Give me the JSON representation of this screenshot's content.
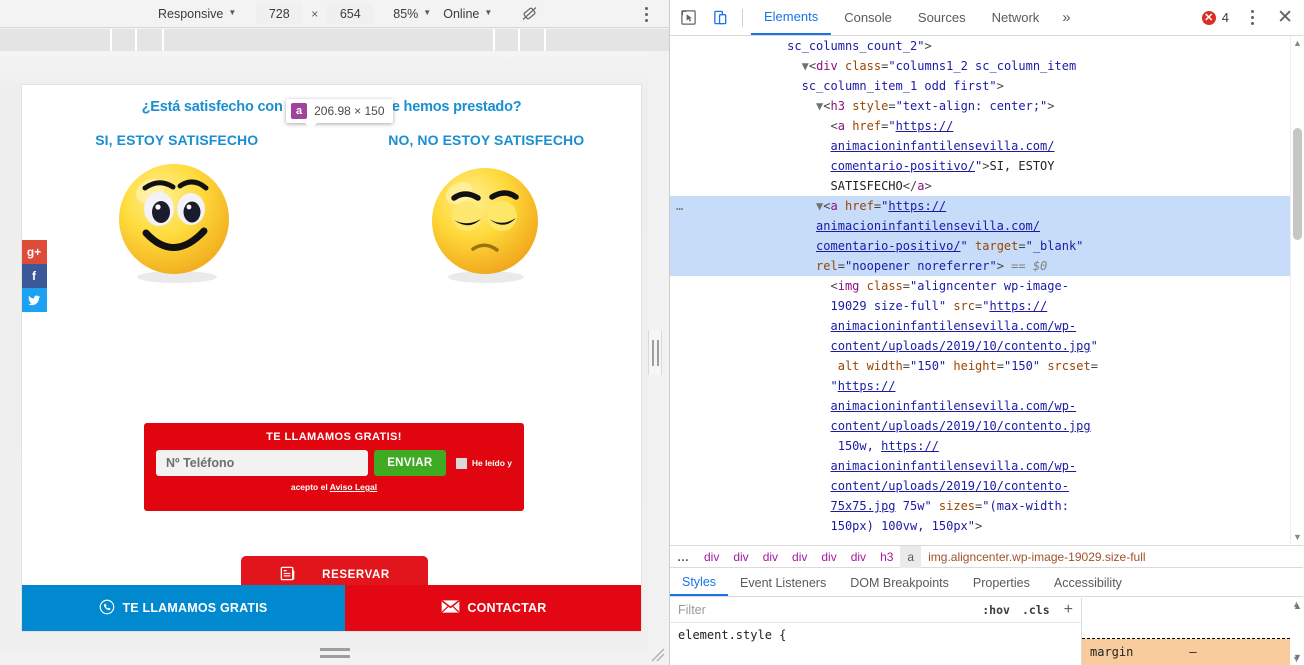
{
  "device_toolbar": {
    "device_label": "Responsive",
    "width": "728",
    "height": "654",
    "zoom": "85%",
    "throttle": "Online",
    "rotate_icon": "rotate-icon",
    "menu_icon": "more-vertical-icon"
  },
  "page": {
    "question": "¿Está satisfecho con el servicio que le hemos prestado?",
    "columns": [
      {
        "heading": "SI, ESTOY SATISFECHO",
        "image": "happy-smiley"
      },
      {
        "heading": "NO, NO ESTOY SATISFECHO",
        "image": "sad-smiley"
      }
    ],
    "social": [
      {
        "name": "google-plus",
        "glyph": "g+",
        "color": "#dd4b39"
      },
      {
        "name": "facebook",
        "glyph": "f",
        "color": "#3b5998"
      },
      {
        "name": "twitter",
        "glyph": "🐦",
        "color": "#1da1f2"
      }
    ],
    "call_form": {
      "title": "TE LLAMAMOS GRATIS!",
      "phone_placeholder": "Nº Teléfono",
      "phone_value": "",
      "submit_label": "ENVIAR",
      "consent_line1": "He leído y",
      "consent_line2_prefix": "acepto el ",
      "consent_link": "Aviso Legal"
    },
    "reserve_button": {
      "label": "RESERVAR",
      "icon": "document-icon"
    },
    "cta_bars": [
      {
        "label": "TE LLAMAMOS GRATIS",
        "icon": "phone-icon",
        "color": "#0089cf"
      },
      {
        "label": "CONTACTAR",
        "icon": "envelope-icon",
        "color": "#e30613"
      }
    ]
  },
  "overlay_tooltip": {
    "tag": "a",
    "dimensions": "206.98 × 150"
  },
  "devtools": {
    "tabs": [
      {
        "label": "Elements",
        "active": true
      },
      {
        "label": "Console",
        "active": false
      },
      {
        "label": "Sources",
        "active": false
      },
      {
        "label": "Network",
        "active": false
      }
    ],
    "more_tabs_glyph": "»",
    "error_count": "4",
    "error_badge_glyph": "✕",
    "inspect_icon": "inspect-element-icon",
    "device_icon": "toggle-device-toolbar-icon",
    "menu_icon": "more-vertical-icon",
    "close_icon": "close-icon",
    "dom": {
      "lines": [
        {
          "indent": 7,
          "selected": false,
          "parts": [
            {
              "t": "attrval",
              "v": "sc_columns_count_2\""
            },
            {
              "t": "punc",
              "v": ">"
            }
          ]
        },
        {
          "indent": 8,
          "selected": false,
          "parts": [
            {
              "t": "arrow",
              "v": "▼"
            },
            {
              "t": "punc",
              "v": "<"
            },
            {
              "t": "tagname",
              "v": "div"
            },
            {
              "t": "txt",
              "v": " "
            },
            {
              "t": "attrname",
              "v": "class"
            },
            {
              "t": "punc",
              "v": "="
            },
            {
              "t": "attrval",
              "v": "\"columns1_2 sc_column_item"
            }
          ]
        },
        {
          "indent": 8,
          "selected": false,
          "parts": [
            {
              "t": "attrval",
              "v": "sc_column_item_1 odd first\""
            },
            {
              "t": "punc",
              "v": ">"
            }
          ]
        },
        {
          "indent": 9,
          "selected": false,
          "parts": [
            {
              "t": "arrow",
              "v": "▼"
            },
            {
              "t": "punc",
              "v": "<"
            },
            {
              "t": "tagname",
              "v": "h3"
            },
            {
              "t": "txt",
              "v": " "
            },
            {
              "t": "attrname",
              "v": "style"
            },
            {
              "t": "punc",
              "v": "="
            },
            {
              "t": "attrval",
              "v": "\"text-align: center;\""
            },
            {
              "t": "punc",
              "v": ">"
            }
          ]
        },
        {
          "indent": 10,
          "selected": false,
          "parts": [
            {
              "t": "punc",
              "v": "<"
            },
            {
              "t": "tagname",
              "v": "a"
            },
            {
              "t": "txt",
              "v": " "
            },
            {
              "t": "attrname",
              "v": "href"
            },
            {
              "t": "punc",
              "v": "="
            },
            {
              "t": "attrval",
              "v": "\""
            },
            {
              "t": "attrlink",
              "v": "https://"
            }
          ]
        },
        {
          "indent": 10,
          "selected": false,
          "parts": [
            {
              "t": "attrlink",
              "v": "animacioninfantilensevilla.com/"
            }
          ]
        },
        {
          "indent": 10,
          "selected": false,
          "parts": [
            {
              "t": "attrlink",
              "v": "comentario-positivo/"
            },
            {
              "t": "attrval",
              "v": "\""
            },
            {
              "t": "punc",
              "v": ">"
            },
            {
              "t": "txt",
              "v": "SI, ESTOY"
            }
          ]
        },
        {
          "indent": 10,
          "selected": false,
          "parts": [
            {
              "t": "txt",
              "v": "SATISFECHO"
            },
            {
              "t": "punc",
              "v": "</"
            },
            {
              "t": "tagname",
              "v": "a"
            },
            {
              "t": "punc",
              "v": ">"
            }
          ]
        },
        {
          "indent": 9,
          "selected": true,
          "gutter": "…",
          "parts": [
            {
              "t": "arrow",
              "v": "▼"
            },
            {
              "t": "punc",
              "v": "<"
            },
            {
              "t": "tagname",
              "v": "a"
            },
            {
              "t": "txt",
              "v": " "
            },
            {
              "t": "attrname",
              "v": "href"
            },
            {
              "t": "punc",
              "v": "="
            },
            {
              "t": "attrval",
              "v": "\""
            },
            {
              "t": "attrlink",
              "v": "https://"
            }
          ]
        },
        {
          "indent": 9,
          "selected": true,
          "parts": [
            {
              "t": "attrlink",
              "v": "animacioninfantilensevilla.com/"
            }
          ]
        },
        {
          "indent": 9,
          "selected": true,
          "parts": [
            {
              "t": "attrlink",
              "v": "comentario-positivo/"
            },
            {
              "t": "attrval",
              "v": "\""
            },
            {
              "t": "txt",
              "v": " "
            },
            {
              "t": "attrname",
              "v": "target"
            },
            {
              "t": "punc",
              "v": "="
            },
            {
              "t": "attrval",
              "v": "\"_blank\""
            }
          ]
        },
        {
          "indent": 9,
          "selected": true,
          "parts": [
            {
              "t": "attrname",
              "v": "rel"
            },
            {
              "t": "punc",
              "v": "="
            },
            {
              "t": "attrval",
              "v": "\"noopener noreferrer\""
            },
            {
              "t": "punc",
              "v": ">"
            },
            {
              "t": "dollar",
              "v": " == $0"
            }
          ]
        },
        {
          "indent": 10,
          "selected": false,
          "parts": [
            {
              "t": "punc",
              "v": "<"
            },
            {
              "t": "tagname",
              "v": "img"
            },
            {
              "t": "txt",
              "v": " "
            },
            {
              "t": "attrname",
              "v": "class"
            },
            {
              "t": "punc",
              "v": "="
            },
            {
              "t": "attrval",
              "v": "\"aligncenter wp-image-"
            }
          ]
        },
        {
          "indent": 10,
          "selected": false,
          "parts": [
            {
              "t": "attrval",
              "v": "19029 size-full\""
            },
            {
              "t": "txt",
              "v": " "
            },
            {
              "t": "attrname",
              "v": "src"
            },
            {
              "t": "punc",
              "v": "="
            },
            {
              "t": "attrval",
              "v": "\""
            },
            {
              "t": "attrlink",
              "v": "https://"
            }
          ]
        },
        {
          "indent": 10,
          "selected": false,
          "parts": [
            {
              "t": "attrlink",
              "v": "animacioninfantilensevilla.com/wp-"
            }
          ]
        },
        {
          "indent": 10,
          "selected": false,
          "parts": [
            {
              "t": "attrlink",
              "v": "content/uploads/2019/10/contento.jpg"
            },
            {
              "t": "attrval",
              "v": "\""
            }
          ]
        },
        {
          "indent": 10,
          "selected": false,
          "parts": [
            {
              "t": "txt",
              "v": " "
            },
            {
              "t": "attrname",
              "v": "alt"
            },
            {
              "t": "txt",
              "v": " "
            },
            {
              "t": "attrname",
              "v": "width"
            },
            {
              "t": "punc",
              "v": "="
            },
            {
              "t": "attrval",
              "v": "\"150\""
            },
            {
              "t": "txt",
              "v": " "
            },
            {
              "t": "attrname",
              "v": "height"
            },
            {
              "t": "punc",
              "v": "="
            },
            {
              "t": "attrval",
              "v": "\"150\""
            },
            {
              "t": "txt",
              "v": " "
            },
            {
              "t": "attrname",
              "v": "srcset"
            },
            {
              "t": "punc",
              "v": "="
            }
          ]
        },
        {
          "indent": 10,
          "selected": false,
          "parts": [
            {
              "t": "attrval",
              "v": "\""
            },
            {
              "t": "attrlink",
              "v": "https://"
            }
          ]
        },
        {
          "indent": 10,
          "selected": false,
          "parts": [
            {
              "t": "attrlink",
              "v": "animacioninfantilensevilla.com/wp-"
            }
          ]
        },
        {
          "indent": 10,
          "selected": false,
          "parts": [
            {
              "t": "attrlink",
              "v": "content/uploads/2019/10/contento.jpg"
            }
          ]
        },
        {
          "indent": 10,
          "selected": false,
          "parts": [
            {
              "t": "txt",
              "v": " "
            },
            {
              "t": "attrval",
              "v": "150w, "
            },
            {
              "t": "attrlink",
              "v": "https://"
            }
          ]
        },
        {
          "indent": 10,
          "selected": false,
          "parts": [
            {
              "t": "attrlink",
              "v": "animacioninfantilensevilla.com/wp-"
            }
          ]
        },
        {
          "indent": 10,
          "selected": false,
          "parts": [
            {
              "t": "attrlink",
              "v": "content/uploads/2019/10/contento-"
            }
          ]
        },
        {
          "indent": 10,
          "selected": false,
          "parts": [
            {
              "t": "attrlink",
              "v": "75x75.jpg"
            },
            {
              "t": "attrval",
              "v": " 75w\""
            },
            {
              "t": "txt",
              "v": " "
            },
            {
              "t": "attrname",
              "v": "sizes"
            },
            {
              "t": "punc",
              "v": "="
            },
            {
              "t": "attrval",
              "v": "\"(max-width:"
            }
          ]
        },
        {
          "indent": 10,
          "selected": false,
          "parts": [
            {
              "t": "attrval",
              "v": "150px) 100vw, 150px\""
            },
            {
              "t": "punc",
              "v": ">"
            }
          ]
        }
      ]
    },
    "breadcrumb": [
      "…",
      "div",
      "div",
      "div",
      "div",
      "div",
      "div",
      "h3",
      "a",
      "img.aligncenter.wp-image-19029.size-full"
    ],
    "breadcrumb_active_index": 8,
    "subtabs": [
      {
        "label": "Styles",
        "active": true
      },
      {
        "label": "Event Listeners",
        "active": false
      },
      {
        "label": "DOM Breakpoints",
        "active": false
      },
      {
        "label": "Properties",
        "active": false
      },
      {
        "label": "Accessibility",
        "active": false
      }
    ],
    "styles": {
      "filter_placeholder": "Filter",
      "filter_value": "",
      "hov_label": ":hov",
      "cls_label": ".cls",
      "plus_label": "+",
      "element_style": "element.style {"
    },
    "box_model": {
      "label": "margin",
      "value": "–"
    }
  }
}
